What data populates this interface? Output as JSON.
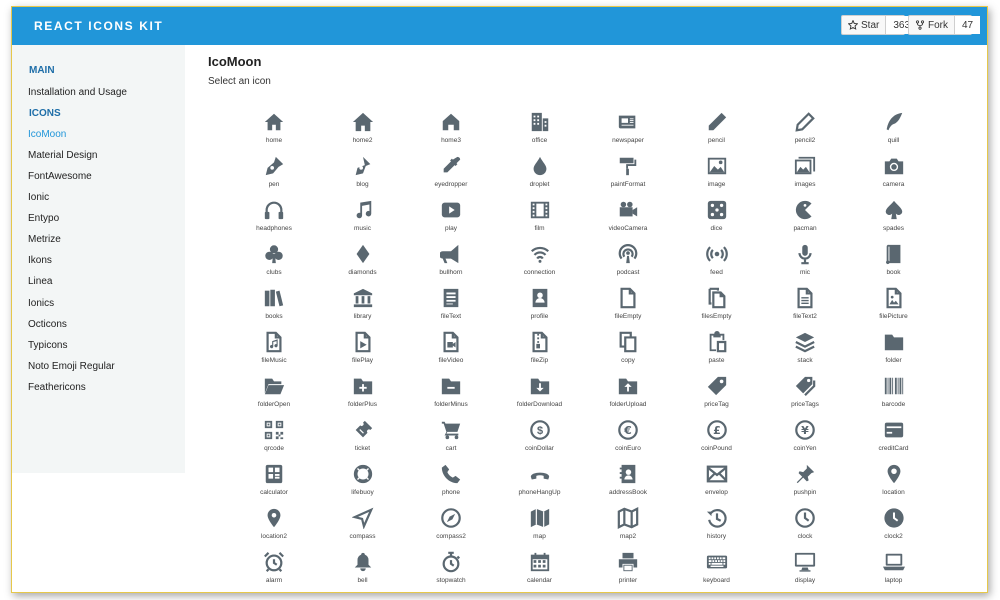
{
  "header": {
    "brand": "REACT ICONS KIT",
    "star_label": "Star",
    "star_count": "363",
    "fork_label": "Fork",
    "fork_count": "47"
  },
  "sidebar": {
    "items": [
      {
        "label": "MAIN",
        "type": "section"
      },
      {
        "label": "Installation and Usage",
        "type": "link"
      },
      {
        "label": "ICONS",
        "type": "section"
      },
      {
        "label": "IcoMoon",
        "type": "active"
      },
      {
        "label": "Material Design",
        "type": "link"
      },
      {
        "label": "FontAwesome",
        "type": "link"
      },
      {
        "label": "Ionic",
        "type": "link"
      },
      {
        "label": "Entypo",
        "type": "link"
      },
      {
        "label": "Metrize",
        "type": "link"
      },
      {
        "label": "Ikons",
        "type": "link"
      },
      {
        "label": "Linea",
        "type": "link"
      },
      {
        "label": "Ionics",
        "type": "link"
      },
      {
        "label": "Octicons",
        "type": "link"
      },
      {
        "label": "Typicons",
        "type": "link"
      },
      {
        "label": "Noto Emoji Regular",
        "type": "link"
      },
      {
        "label": "Feathericons",
        "type": "link"
      }
    ]
  },
  "main": {
    "title": "IcoMoon",
    "subtitle": "Select an icon",
    "icons": [
      "home",
      "home2",
      "home3",
      "office",
      "newspaper",
      "pencil",
      "pencil2",
      "quill",
      "pen",
      "blog",
      "eyedropper",
      "droplet",
      "paintFormat",
      "image",
      "images",
      "camera",
      "headphones",
      "music",
      "play",
      "film",
      "videoCamera",
      "dice",
      "pacman",
      "spades",
      "clubs",
      "diamonds",
      "bullhorn",
      "connection",
      "podcast",
      "feed",
      "mic",
      "book",
      "books",
      "library",
      "fileText",
      "profile",
      "fileEmpty",
      "filesEmpty",
      "fileText2",
      "filePicture",
      "fileMusic",
      "filePlay",
      "fileVideo",
      "fileZip",
      "copy",
      "paste",
      "stack",
      "folder",
      "folderOpen",
      "folderPlus",
      "folderMinus",
      "folderDownload",
      "folderUpload",
      "priceTag",
      "priceTags",
      "barcode",
      "qrcode",
      "ticket",
      "cart",
      "coinDollar",
      "coinEuro",
      "coinPound",
      "coinYen",
      "creditCard",
      "calculator",
      "lifebuoy",
      "phone",
      "phoneHangUp",
      "addressBook",
      "envelop",
      "pushpin",
      "location",
      "location2",
      "compass",
      "compass2",
      "map",
      "map2",
      "history",
      "clock",
      "clock2",
      "alarm",
      "bell",
      "stopwatch",
      "calendar",
      "printer",
      "keyboard",
      "display",
      "laptop"
    ],
    "icon_color": "#5a6770"
  },
  "colors": {
    "topbar": "#2196d9",
    "sidebar_bg": "#f3f6f6",
    "section": "#1e6ea8",
    "active": "#2196d9"
  }
}
